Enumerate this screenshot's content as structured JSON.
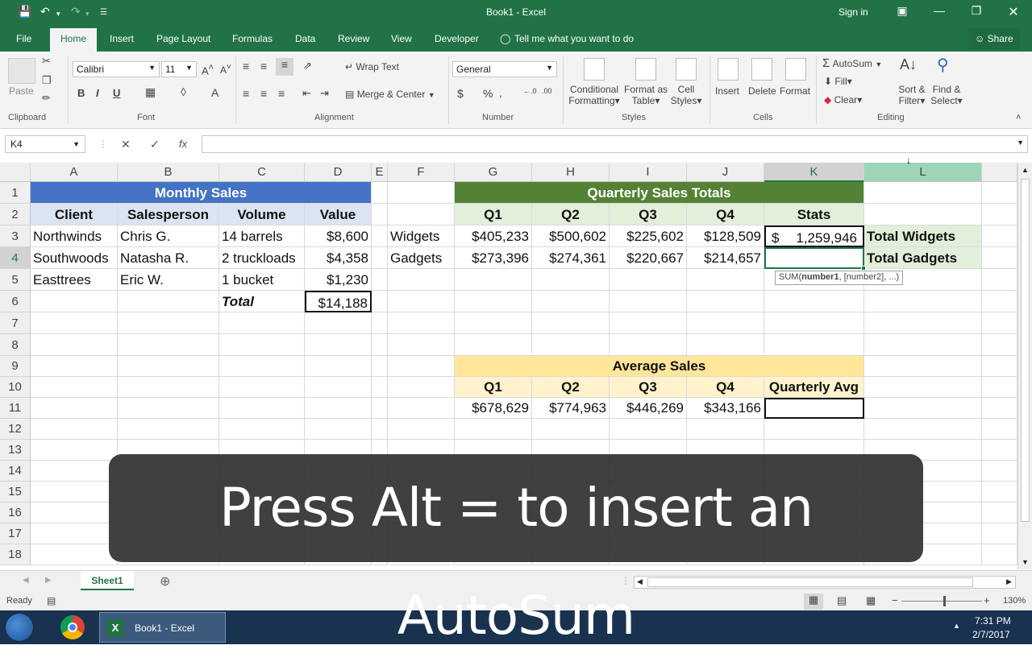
{
  "window": {
    "title": "Book1 - Excel",
    "sign_in": "Sign in",
    "share": "Share",
    "tell_me": "Tell me what you want to do"
  },
  "tabs": [
    "File",
    "Home",
    "Insert",
    "Page Layout",
    "Formulas",
    "Data",
    "Review",
    "View",
    "Developer"
  ],
  "ribbon": {
    "clipboard": {
      "paste": "Paste",
      "label": "Clipboard"
    },
    "font": {
      "name": "Calibri",
      "size": "11",
      "label": "Font"
    },
    "alignment": {
      "wrap": "Wrap Text",
      "merge": "Merge & Center",
      "label": "Alignment"
    },
    "number": {
      "format": "General",
      "label": "Number"
    },
    "styles": {
      "conditional": "Conditional",
      "conditional2": "Formatting",
      "format_as": "Format as",
      "format_as2": "Table",
      "cell": "Cell",
      "cell2": "Styles",
      "label": "Styles"
    },
    "cells": {
      "insert": "Insert",
      "delete": "Delete",
      "format": "Format",
      "label": "Cells"
    },
    "editing": {
      "autosum": "AutoSum",
      "fill": "Fill",
      "clear": "Clear",
      "sort": "Sort &",
      "sort2": "Filter",
      "find": "Find &",
      "find2": "Select",
      "label": "Editing"
    }
  },
  "formula_bar": {
    "name_box": "K4",
    "fx": "fx",
    "formula": ""
  },
  "columns": [
    "A",
    "B",
    "C",
    "D",
    "E",
    "F",
    "G",
    "H",
    "I",
    "J",
    "K",
    "L"
  ],
  "rows": [
    "1",
    "2",
    "3",
    "4",
    "5",
    "6",
    "7",
    "8",
    "9",
    "10",
    "11",
    "12",
    "13",
    "14",
    "15",
    "16",
    "17",
    "18"
  ],
  "sheet": {
    "monthly_title": "Monthly Sales",
    "monthly_headers": [
      "Client",
      "Salesperson",
      "Volume",
      "Value"
    ],
    "monthly_rows": [
      [
        "Northwinds",
        "Chris G.",
        "14 barrels",
        "$8,600"
      ],
      [
        "Southwoods",
        "Natasha R.",
        "2 truckloads",
        "$4,358"
      ],
      [
        "Easttrees",
        "Eric W.",
        "1 bucket",
        "$1,230"
      ]
    ],
    "total_label": "Total",
    "total_value": "$14,188",
    "quarterly_title": "Quarterly Sales Totals",
    "quarterly_headers": [
      "Q1",
      "Q2",
      "Q3",
      "Q4",
      "Stats"
    ],
    "widgets_label": "Widgets",
    "widgets": [
      "$405,233",
      "$500,602",
      "$225,602",
      "$128,509"
    ],
    "widgets_stat_cur": "$",
    "widgets_stat": "1,259,946",
    "gadgets_label": "Gadgets",
    "gadgets": [
      "$273,396",
      "$274,361",
      "$220,667",
      "$214,657"
    ],
    "total_widgets": "Total Widgets",
    "total_gadgets": "Total Gadgets",
    "tooltip_fn": "SUM(",
    "tooltip_arg1": "number1",
    "tooltip_rest": ", [number2], ...)",
    "average_title": "Average Sales",
    "average_headers": [
      "Q1",
      "Q2",
      "Q3",
      "Q4",
      "Quarterly Avg"
    ],
    "average_values": [
      "$678,629",
      "$774,963",
      "$446,269",
      "$343,166"
    ]
  },
  "sheet_tab": "Sheet1",
  "status": {
    "ready": "Ready",
    "zoom": "130%"
  },
  "taskbar": {
    "excel_item": "Book1 - Excel",
    "time": "7:31 PM",
    "date": "2/7/2017"
  },
  "caption": "Press Alt = to insert an AutoSum",
  "colors": {
    "excel_green": "#217346",
    "blue_header": "#4472c4",
    "light_blue": "#dbe5f1",
    "green_header": "#548235",
    "light_green": "#e2efda",
    "yellow_header": "#ffe699",
    "light_yellow": "#fff2cc"
  }
}
